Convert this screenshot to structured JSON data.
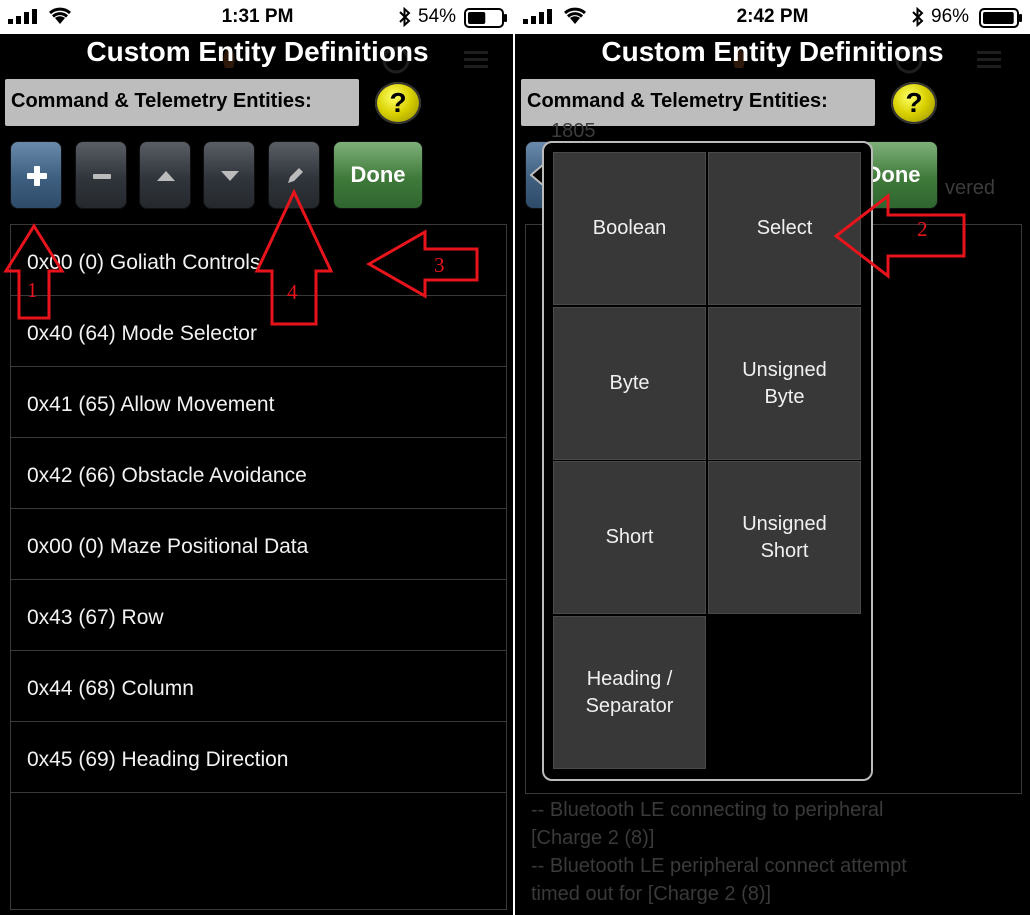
{
  "left_screen": {
    "status": {
      "time": "1:31 PM",
      "battery_pct": "54%",
      "battery_level": 0.54
    },
    "title": "Custom Entity Definitions",
    "section_label": "Command & Telemetry Entities:",
    "help_label": "?",
    "toolbar": [
      {
        "icon": "plus-icon"
      },
      {
        "icon": "minus-icon"
      },
      {
        "icon": "arrow-up-icon"
      },
      {
        "icon": "arrow-down-icon"
      },
      {
        "icon": "pencil-icon"
      }
    ],
    "done_label": "Done",
    "entities": [
      "0x00 (0) Goliath Controls",
      "0x40 (64) Mode Selector",
      "0x41 (65) Allow Movement",
      "0x42 (66) Obstacle Avoidance",
      "0x00 (0) Maze Positional Data",
      "0x43 (67) Row",
      "0x44 (68) Column",
      "0x45 (69) Heading Direction"
    ],
    "annotations": [
      "1",
      "4",
      "3"
    ]
  },
  "right_screen": {
    "status": {
      "time": "2:42 PM",
      "battery_pct": "96%",
      "battery_level": 0.96
    },
    "title": "Custom Entity Definitions",
    "section_label": "Command & Telemetry Entities:",
    "help_label": "?",
    "done_label": "Done",
    "background_text": {
      "number": "1805",
      "fragment": "vered"
    },
    "type_picker": {
      "options": [
        "Boolean",
        "Select",
        "Byte",
        "Unsigned\nByte",
        "Short",
        "Unsigned\nShort",
        "Heading /\nSeparator"
      ]
    },
    "log_lines": [
      "-- Bluetooth LE connecting to peripheral",
      "[Charge 2 (8)]",
      "-- Bluetooth LE peripheral connect attempt",
      "timed out for [Charge 2 (8)]"
    ],
    "annotations": [
      "2"
    ]
  },
  "colors": {
    "annotation": "#e8141c",
    "done_button": "#3f7a3a",
    "help_button": "#d8d000"
  }
}
